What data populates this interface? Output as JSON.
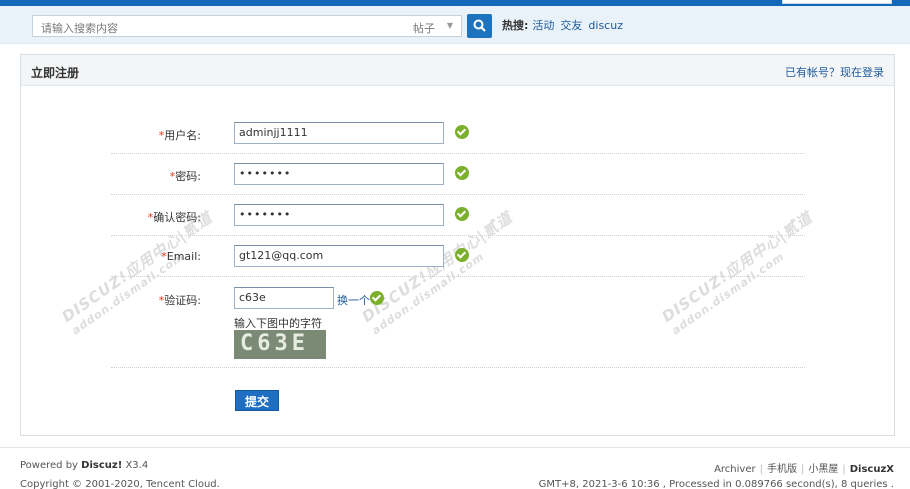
{
  "search": {
    "placeholder": "请输入搜索内容",
    "type_label": "帖子",
    "hot_label": "热搜:",
    "hot_links": [
      "活动",
      "交友",
      "discuz"
    ]
  },
  "panel": {
    "title": "立即注册",
    "login_link": "已有帐号？现在登录"
  },
  "form": {
    "required_mark": "*",
    "username": {
      "label": "用户名:",
      "value": "adminjj1111"
    },
    "password": {
      "label": "密码:",
      "value": "•••••••"
    },
    "confirm_password": {
      "label": "确认密码:",
      "value": "•••••••"
    },
    "email": {
      "label": "Email:",
      "value": "gt121@qq.com"
    },
    "captcha": {
      "label": "验证码:",
      "value": "c63e",
      "change_link": "换一个",
      "hint": "输入下图中的字符",
      "image_text": "C63E"
    },
    "submit_label": "提交"
  },
  "watermark": {
    "text": "DISCUZ!应用中心|贰道",
    "url": "addon.dismall.com"
  },
  "footer": {
    "powered_prefix": "Powered by",
    "brand": "Discuz!",
    "version": "X3.4",
    "copyright": "Copyright © 2001-2020, Tencent Cloud.",
    "links": [
      "Archiver",
      "手机版",
      "小黑屋"
    ],
    "brand_right": "DiscuzX",
    "stats": "GMT+8, 2021-3-6 10:36 , Processed in 0.089766 second(s), 8 queries ."
  },
  "colors": {
    "accent": "#1e73be",
    "link": "#1d5a9a",
    "required": "#e0340f",
    "ok": "#7ab02c"
  }
}
